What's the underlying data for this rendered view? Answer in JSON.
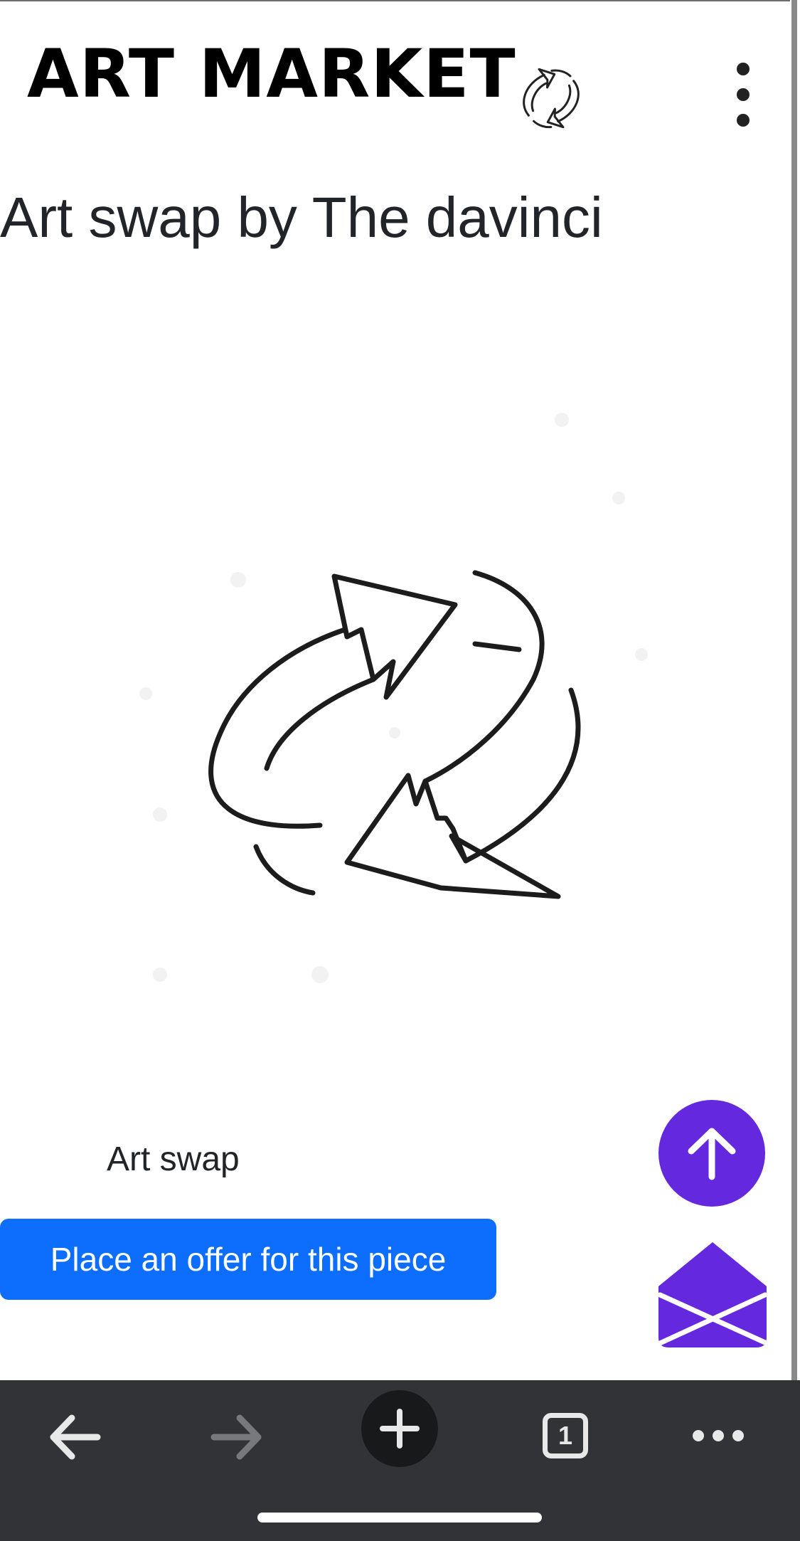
{
  "header": {
    "brand": "ART MARKET",
    "logo_icon": "swap-arrows-icon",
    "menu_icon": "vertical-dots-icon"
  },
  "listing": {
    "title": "Art swap by The davinci",
    "image_icon": "swap-arrows-icon",
    "caption": "Art swap",
    "offer_button": "Place an offer for this piece"
  },
  "fabs": {
    "scroll_top_icon": "arrow-up-icon",
    "mail_icon": "envelope-open-icon"
  },
  "browser_bar": {
    "tab_count": "1",
    "back_icon": "arrow-left-icon",
    "forward_icon": "arrow-right-icon",
    "new_tab_icon": "plus-icon",
    "more_icon": "horizontal-dots-icon"
  },
  "colors": {
    "accent": "#6429df",
    "primary_button": "#0d6efd",
    "toolbar": "#313337"
  }
}
